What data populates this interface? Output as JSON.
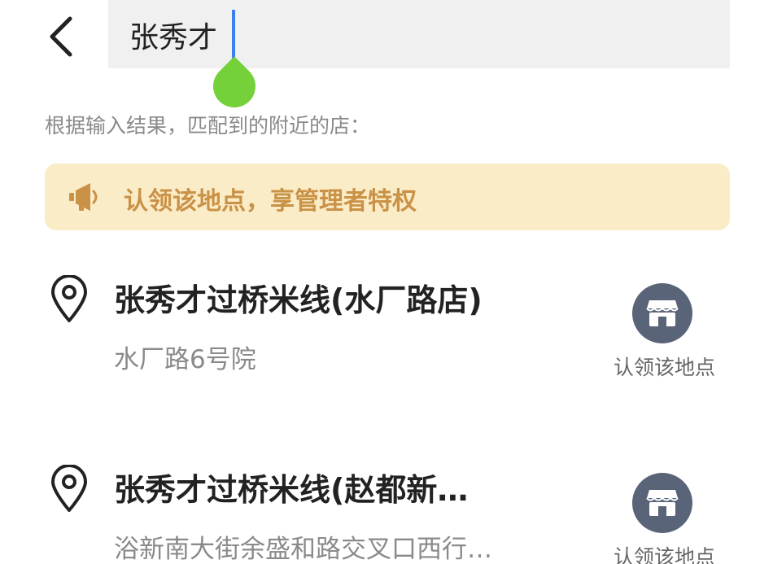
{
  "search": {
    "value": "张秀才",
    "placeholder": ""
  },
  "hint": "根据输入结果，匹配到的附近的店：",
  "banner": {
    "text": "认领该地点，享管理者特权",
    "accent_color": "#c99246",
    "background_color": "#fbecc8"
  },
  "results": [
    {
      "name": "张秀才过桥米线(水厂路店)",
      "address": "水厂路6号院",
      "claim_label": "认领该地点"
    },
    {
      "name": "张秀才过桥米线(赵都新…",
      "address": "浴新南大街余盛和路交叉口西行…",
      "claim_label": "认领该地点"
    }
  ],
  "icons": {
    "back": "chevron-left-icon",
    "clear": "close-circle-icon",
    "banner": "megaphone-icon",
    "location": "location-pin-icon",
    "claim": "storefront-icon"
  }
}
